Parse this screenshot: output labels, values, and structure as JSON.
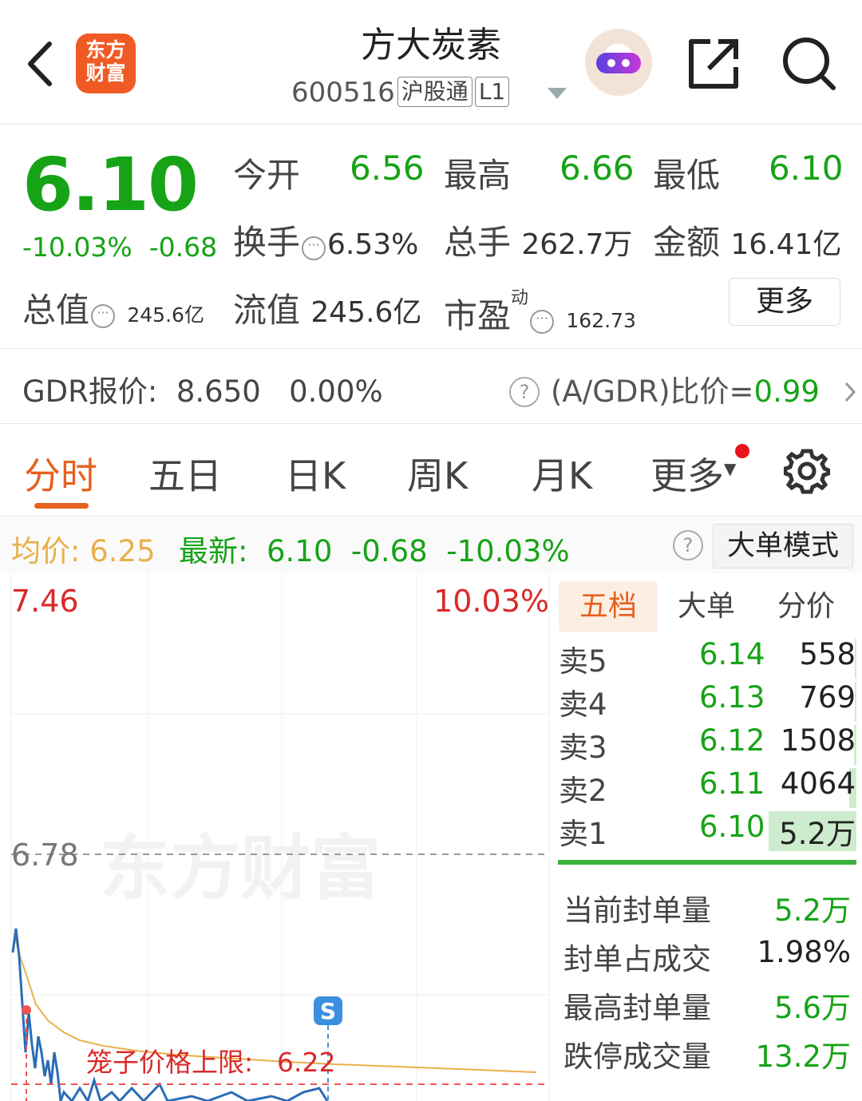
{
  "header": {
    "title": "方大炭素",
    "code": "600516",
    "badge_hk": "沪股通",
    "badge_level": "L1",
    "logo_text": "东方财富"
  },
  "quote": {
    "price": "6.10",
    "change_pct": "-10.03%",
    "change": "-0.68",
    "open_label": "今开",
    "open": "6.56",
    "high_label": "最高",
    "high": "6.66",
    "low_label": "最低",
    "low": "6.10",
    "turnover_label": "换手",
    "turnover": "6.53%",
    "volume_label": "总手",
    "volume": "262.7万",
    "amount_label": "金额",
    "amount": "16.41亿",
    "mktcap_label": "总值",
    "mktcap": "245.6亿",
    "float_label": "流值",
    "float": "245.6亿",
    "pe_label": "市盈",
    "pe_sup": "动",
    "pe": "162.73",
    "more_label": "更多"
  },
  "gdr": {
    "label": "GDR报价:",
    "price": "8.650",
    "pct": "0.00%",
    "ratio_label": "(A/GDR)比价=",
    "ratio": "0.99"
  },
  "tabs": [
    "分时",
    "五日",
    "日K",
    "周K",
    "月K",
    "更多"
  ],
  "infobar": {
    "avg_label": "均价:",
    "avg": "6.25",
    "latest_label": "最新:",
    "latest": "6.10",
    "change": "-0.68",
    "pct": "-10.03%",
    "mode_label": "大单模式"
  },
  "chart": {
    "y_top": "7.46",
    "pct_top": "10.03%",
    "y_mid": "6.78",
    "cage_label": "笼子价格上限:",
    "cage_value": "6.22",
    "s_marker": "S",
    "watermark": "东方财富"
  },
  "orderbook": {
    "tabs": [
      "五档",
      "大单",
      "分价"
    ],
    "asks": [
      {
        "name": "卖5",
        "price": "6.14",
        "vol": "558",
        "fill": 0.01
      },
      {
        "name": "卖4",
        "price": "6.13",
        "vol": "769",
        "fill": 0.015
      },
      {
        "name": "卖3",
        "price": "6.12",
        "vol": "1508",
        "fill": 0.03
      },
      {
        "name": "卖2",
        "price": "6.11",
        "vol": "4064",
        "fill": 0.08
      },
      {
        "name": "卖1",
        "price": "6.10",
        "vol": "5.2万",
        "fill": 1.0
      }
    ],
    "stats": [
      {
        "k": "当前封单量",
        "v": "5.2万",
        "color": "#16a316"
      },
      {
        "k": "封单占成交",
        "v": "1.98%",
        "color": "#222222"
      },
      {
        "k": "最高封单量",
        "v": "5.6万",
        "color": "#16a316"
      },
      {
        "k": "跌停成交量",
        "v": "13.2万",
        "color": "#16a316"
      }
    ]
  },
  "colors": {
    "down": "#16a316",
    "up": "#d92a2a",
    "accent": "#e6611e",
    "avg_line": "#e8b04a",
    "price_line": "#2a6db5"
  },
  "icons": [
    "back-icon",
    "share-icon",
    "search-icon",
    "gear-icon",
    "help-icon",
    "chevron-right-icon",
    "more-dots-icon"
  ]
}
